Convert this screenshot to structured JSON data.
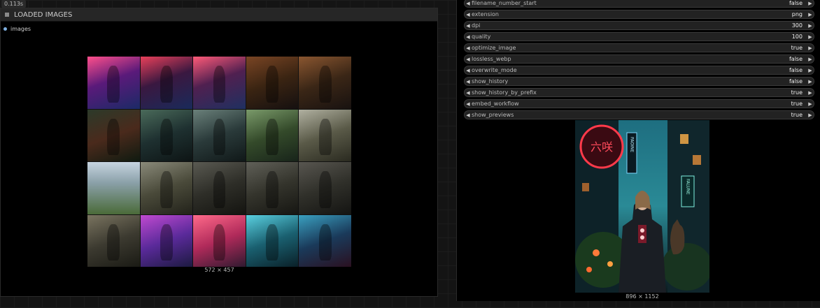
{
  "timing": "0.113s",
  "load_node": {
    "title": "LOADED IMAGES",
    "output_label": "images",
    "caption": "572 × 457",
    "thumbnails": [
      {
        "name": "dancer-red-neon",
        "bg": "linear-gradient(160deg,#ff4f8b,#5a1a7a 45%,#1b2a66)"
      },
      {
        "name": "dancer-red-2",
        "bg": "linear-gradient(160deg,#e9405a,#3a1840 45%,#192a5a)"
      },
      {
        "name": "dancer-red-3",
        "bg": "linear-gradient(160deg,#ff5a78,#502050 45%,#1f3060)"
      },
      {
        "name": "redhead-casino",
        "bg": "linear-gradient(160deg,#7a4524,#3a2412 50%,#151010)"
      },
      {
        "name": "redhead-casino-2",
        "bg": "linear-gradient(160deg,#8a5630,#3a2616 50%,#181210)"
      },
      {
        "name": "redhead-dark-dress",
        "bg": "linear-gradient(160deg,#2c3a2a,#4a2a1c 50%,#0f1a10)"
      },
      {
        "name": "dark-forest-woman",
        "bg": "linear-gradient(160deg,#4a6a5a,#1e3030 50%,#0d1414)"
      },
      {
        "name": "dark-forest-woman-2",
        "bg": "linear-gradient(160deg,#6a807a,#2a3a3a 50%,#101818)"
      },
      {
        "name": "forest-creature",
        "bg": "linear-gradient(160deg,#7a9a6a,#344a2a 50%,#18241a)"
      },
      {
        "name": "bicycle-forest",
        "bg": "linear-gradient(160deg,#b0b0a0,#5a5a48 50%,#2a2a20)"
      },
      {
        "name": "mountain-village",
        "bg": "linear-gradient(180deg,#c6d4e0,#8aa0a8 40%,#4a6a38)"
      },
      {
        "name": "blonde-soldier",
        "bg": "linear-gradient(160deg,#8a8a7a,#4a4a3a 50%,#22221a)"
      },
      {
        "name": "blonde-sitting",
        "bg": "linear-gradient(160deg,#5a5a52,#2e2e28 50%,#141410)"
      },
      {
        "name": "blonde-sitting-2",
        "bg": "linear-gradient(160deg,#606058,#34342c 50%,#161612)"
      },
      {
        "name": "blonde-sitting-3",
        "bg": "linear-gradient(160deg,#585650,#30302a 50%,#141412)"
      },
      {
        "name": "blonde-rubble",
        "bg": "linear-gradient(160deg,#7a7460,#3c3a30 50%,#1a1a14)"
      },
      {
        "name": "neon-pink-dress",
        "bg": "linear-gradient(160deg,#c04ad0,#5a2a9a 50%,#1c1a40)"
      },
      {
        "name": "neon-red-dress",
        "bg": "linear-gradient(160deg,#ff6a8a,#b02a5a 50%,#301a30)"
      },
      {
        "name": "cyber-jacket",
        "bg": "linear-gradient(160deg,#5ad0e0,#1a6070 50%,#0a2028)"
      },
      {
        "name": "cyber-hood",
        "bg": "linear-gradient(160deg,#3aa0c0,#1a3a5a 50%,#2a1020)"
      }
    ]
  },
  "save_node": {
    "widgets": [
      {
        "label": "filename_number_start",
        "value": "false"
      },
      {
        "label": "extension",
        "value": "png"
      },
      {
        "label": "dpi",
        "value": "300"
      },
      {
        "label": "quality",
        "value": "100"
      },
      {
        "label": "optimize_image",
        "value": "true"
      },
      {
        "label": "lossless_webp",
        "value": "false"
      },
      {
        "label": "overwrite_mode",
        "value": "false"
      },
      {
        "label": "show_history",
        "value": "false"
      },
      {
        "label": "show_history_by_prefix",
        "value": "true"
      },
      {
        "label": "embed_workflow",
        "value": "true"
      },
      {
        "label": "show_previews",
        "value": "true"
      }
    ],
    "preview_caption": "896 × 1152",
    "preview_sign_text": "PAOINE",
    "preview_sign_text_2": "FALUNE"
  },
  "colors": {
    "canvas": "#141414",
    "node": "#000000",
    "widget_bg": "#222222",
    "slot": "#7fb0e0"
  }
}
